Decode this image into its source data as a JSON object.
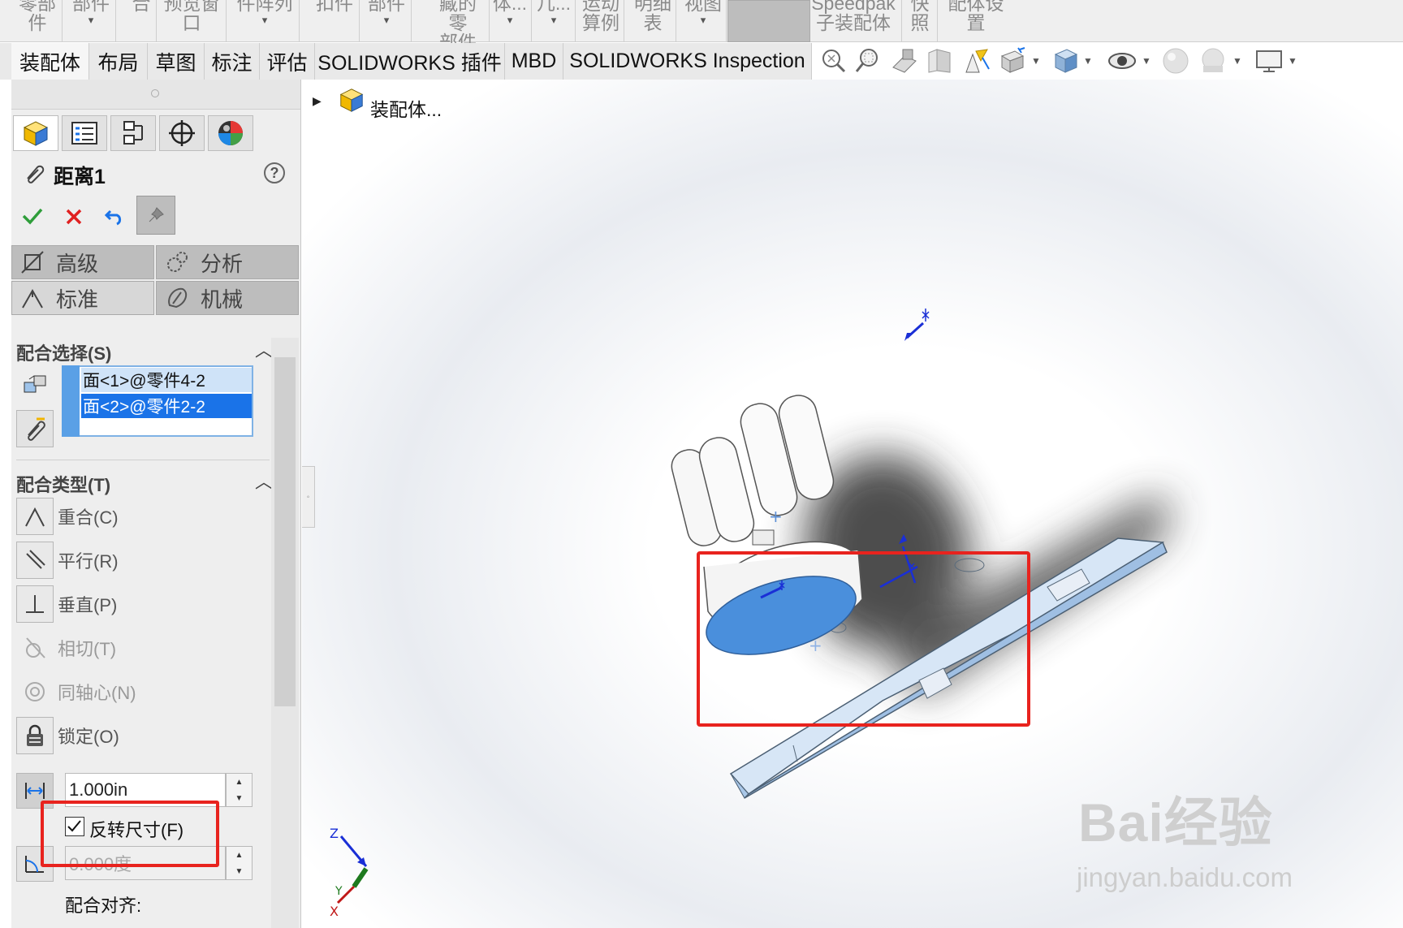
{
  "ribbon": {
    "buttons": [
      {
        "line1": "零部",
        "line2": "件",
        "arrow": ""
      },
      {
        "line1": "部件",
        "line2": "",
        "arrow": "▾"
      },
      {
        "line1": "合",
        "line2": "",
        "arrow": ""
      },
      {
        "line1": "预览窗",
        "line2": "口",
        "arrow": ""
      },
      {
        "line1": "件阵列",
        "line2": "",
        "arrow": "▾"
      },
      {
        "line1": "扣件",
        "line2": "",
        "arrow": ""
      },
      {
        "line1": "部件",
        "line2": "",
        "arrow": "▾"
      },
      {
        "line1": "藏的零",
        "line2": "部件",
        "arrow": ""
      },
      {
        "line1": "体...",
        "line2": "",
        "arrow": "▾"
      },
      {
        "line1": "几...",
        "line2": "",
        "arrow": "▾"
      },
      {
        "line1": "运动",
        "line2": "算例",
        "arrow": ""
      },
      {
        "line1": "明细",
        "line2": "表",
        "arrow": ""
      },
      {
        "line1": "视图",
        "line2": "",
        "arrow": "▾"
      },
      {
        "line1": "Speedpak",
        "line2": "子装配体",
        "arrow": ""
      },
      {
        "line1": "快",
        "line2": "照",
        "arrow": ""
      },
      {
        "line1": "配体设",
        "line2": "置",
        "arrow": ""
      }
    ]
  },
  "tabs": [
    "装配体",
    "布局",
    "草图",
    "标注",
    "评估",
    "SOLIDWORKS 插件",
    "MBD",
    "SOLIDWORKS Inspection"
  ],
  "view_toolbar_icons": [
    "zoom-to-fit-icon",
    "zoom-area-icon",
    "section-view-icon",
    "view-orientation-icon",
    "dynamic-annotation-icon",
    "view-settings-icon",
    "display-style-icon",
    "hide-show-icon",
    "appearance-icon",
    "scene-icon",
    "monitor-icon"
  ],
  "panel": {
    "tab_icons": [
      "feature-manager-icon",
      "property-manager-icon",
      "configuration-manager-icon",
      "dimxpert-icon",
      "display-manager-icon"
    ],
    "title": "距离1",
    "help": "?",
    "modes": {
      "advanced": "高级",
      "analysis": "分析",
      "standard": "标准",
      "mechanical": "机械"
    },
    "mate_selections": {
      "header": "配合选择(S)",
      "items": [
        "面<1>@零件4-2",
        "面<2>@零件2-2"
      ]
    },
    "mate_types": {
      "header": "配合类型(T)",
      "items": [
        "重合(C)",
        "平行(R)",
        "垂直(P)",
        "相切(T)",
        "同轴心(N)",
        "锁定(O)"
      ]
    },
    "distance_value": "1.000in",
    "flip_dimension": {
      "label": "反转尺寸(F)",
      "checked": true
    },
    "angle_value": "0.000度",
    "mate_alignment": "配合对齐:"
  },
  "graphics": {
    "tree_label": "装配体...",
    "triad": {
      "x": "X",
      "y": "Y",
      "z": "Z"
    },
    "watermark": "Bai经验",
    "watermark_url": "jingyan.baidu.com"
  },
  "colors": {
    "highlight_red": "#e8231e",
    "selection_blue": "#1a73e8",
    "face_blue": "#4a8fdc"
  }
}
